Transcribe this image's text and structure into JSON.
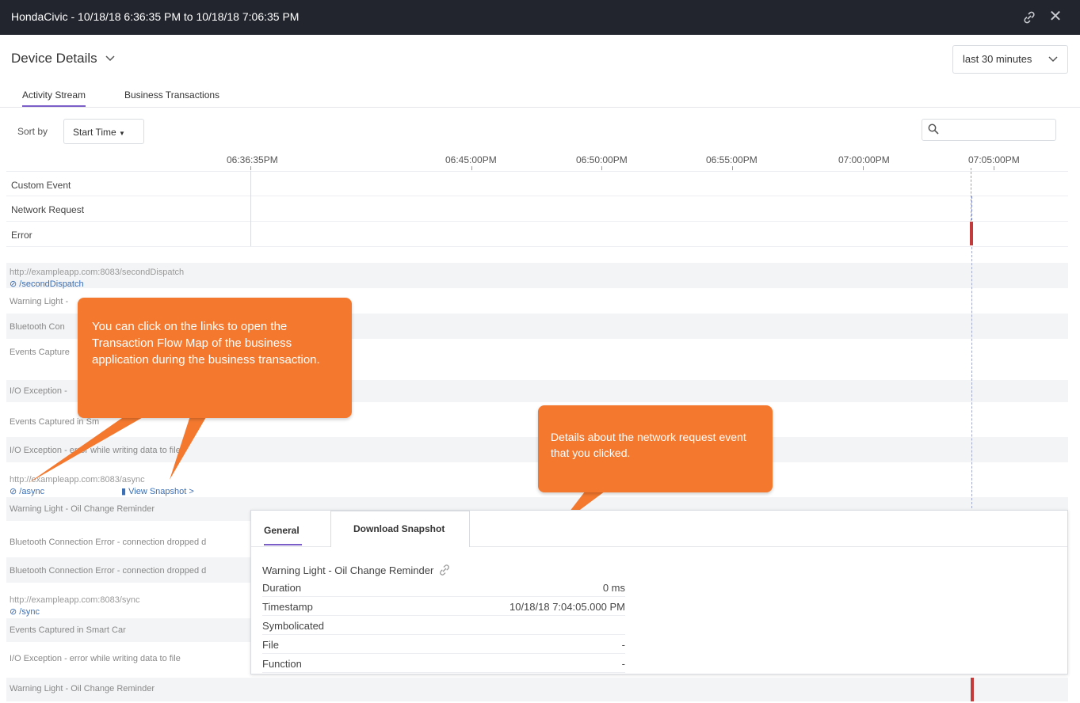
{
  "window": {
    "title": "HondaCivic - 10/18/18 6:36:35 PM to 10/18/18 7:06:35 PM",
    "link_icon": "link-icon",
    "close_icon": "close-icon",
    "close_glyph": "✕"
  },
  "header": {
    "title": "Device Details",
    "time_range": "last 30 minutes"
  },
  "tabs": [
    {
      "label": "Activity Stream",
      "active": true
    },
    {
      "label": "Business Transactions",
      "active": false
    }
  ],
  "sort": {
    "label": "Sort by",
    "value": "Start Time",
    "search_placeholder": ""
  },
  "timeline": {
    "ticks": [
      "06:36:35PM",
      "06:45:00PM",
      "06:50:00PM",
      "06:55:00PM",
      "07:00:00PM",
      "07:05:00PM"
    ],
    "lanes": [
      "Custom Event",
      "Network Request",
      "Error"
    ]
  },
  "events": [
    {
      "url": "http://exampleapp.com:8083/secondDispatch",
      "path": "⊘ /secondDispatch"
    },
    {
      "text": "Warning Light - "
    },
    {
      "text": "Bluetooth Con"
    },
    {
      "text": "Events Capture"
    },
    {
      "text": "I/O Exception -"
    },
    {
      "text": "Events Captured in Sm"
    },
    {
      "text": "I/O Exception - error while writing data to file"
    },
    {
      "url": "http://exampleapp.com:8083/async",
      "path": "⊘ /async",
      "snapshot": "View Snapshot >"
    },
    {
      "text": "Warning Light - Oil Change Reminder"
    },
    {
      "text": "Bluetooth Connection Error - connection dropped d"
    },
    {
      "text": "Bluetooth Connection Error - connection dropped d"
    },
    {
      "url": "http://exampleapp.com:8083/sync",
      "path": "⊘ /sync"
    },
    {
      "text": "Events Captured in Smart Car"
    },
    {
      "text": "I/O Exception - error while writing data to file"
    },
    {
      "text": "Warning Light - Oil Change Reminder"
    }
  ],
  "callouts": {
    "links": "You can click on the links to open the Transaction Flow Map of the business application during the business transaction.",
    "details": "Details about the network request event that you clicked."
  },
  "detail_panel": {
    "tabs": [
      "General",
      "Download Snapshot"
    ],
    "event_title": "Warning Light - Oil Change Reminder",
    "fields": [
      {
        "key": "Duration",
        "value": "0 ms"
      },
      {
        "key": "Timestamp",
        "value": "10/18/18 7:04:05.000 PM"
      },
      {
        "key": "Symbolicated",
        "value": ""
      },
      {
        "key": "File",
        "value": "-"
      },
      {
        "key": "Function",
        "value": "-"
      }
    ]
  },
  "colors": {
    "titlebar": "#22252d",
    "accent": "#7c5ec9",
    "callout": "#f4792f",
    "error_marker": "#c33b3b",
    "link": "#3b6fb6"
  }
}
